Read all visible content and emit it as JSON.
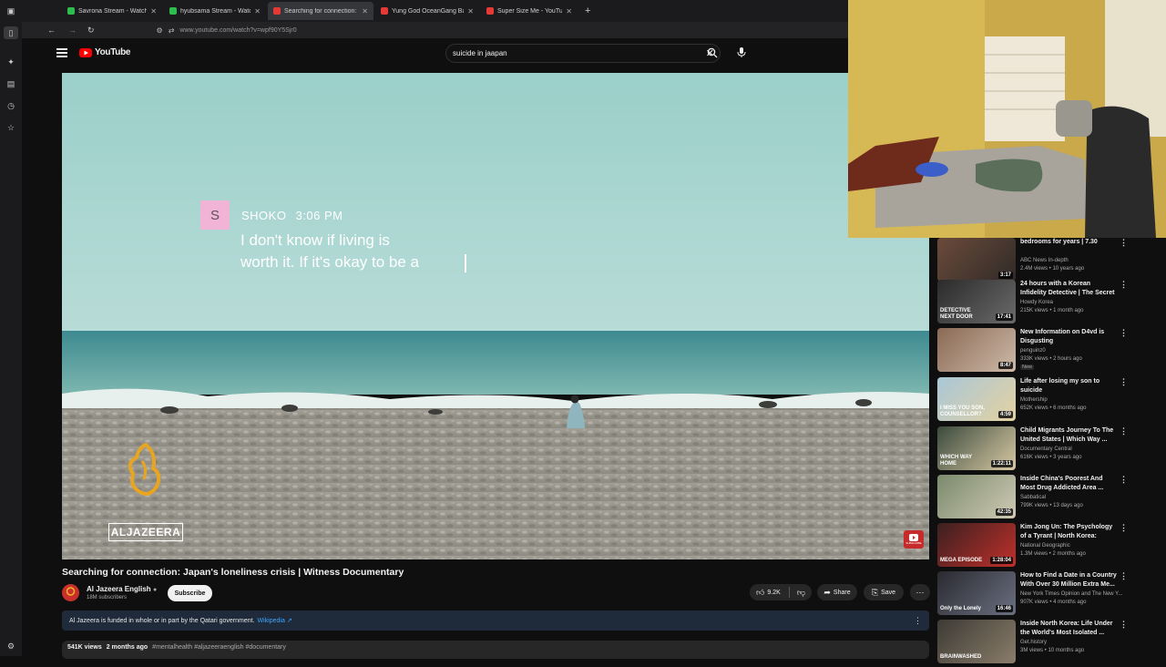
{
  "browser": {
    "tabs": [
      {
        "title": "Savrona Stream - Watch Live o",
        "color": "#2dbd4e",
        "active": false
      },
      {
        "title": "hyubsama Stream - Watch Live",
        "color": "#2dbd4e",
        "active": false
      },
      {
        "title": "Searching for connection: J",
        "color": "#e53935",
        "active": true
      },
      {
        "title": "Yung God OceanGang Based F",
        "color": "#e53935",
        "active": false
      },
      {
        "title": "Super Size Me - YouTube",
        "color": "#e53935",
        "active": false
      }
    ],
    "url": "www.youtube.com/watch?v=wpf90Y5Sjr0"
  },
  "masthead": {
    "logo_text": "YouTube",
    "search_value": "suicide in jaapan"
  },
  "video": {
    "overlay_initial": "S",
    "overlay_name": "SHOKO",
    "overlay_time": "3:06 PM",
    "overlay_line1": "I don't know if living is",
    "overlay_line2": "worth it. If it's okay to be a",
    "brand": "ALJAZEERA",
    "subscribe_overlay": "SUBSCRIBE"
  },
  "info": {
    "title": "Searching for connection: Japan's loneliness crisis | Witness Documentary",
    "channel": "Al Jazeera English",
    "subscribers": "18M subscribers",
    "subscribe": "Subscribe",
    "likes": "9.2K",
    "share": "Share",
    "save": "Save",
    "funding_text": "Al Jazeera is funded in whole or in part by the Qatari government.",
    "funding_link": "Wikipedia",
    "views": "541K views",
    "age": "2 months ago",
    "hashtags": "#mentalhealth #aljazeeraenglish #documentary"
  },
  "recommendations": [
    {
      "title": "bedrooms for years | 7.30",
      "channel": "ABC News In-depth",
      "meta": "2.4M views • 10 years ago",
      "duration": "3:17",
      "badge": ""
    },
    {
      "title": "24 hours with a Korean Infidelity Detective | The Secret Busines...",
      "channel": "Howdy Korea",
      "meta": "215K views • 1 month ago",
      "duration": "17:41",
      "badge": ""
    },
    {
      "title": "New Information on D4vd is Disgusting",
      "channel": "penguinz0",
      "meta": "333K views • 2 hours ago",
      "duration": "8:47",
      "badge": "New"
    },
    {
      "title": "Life after losing my son to suicide",
      "channel": "Mothership",
      "meta": "652K views • 6 months ago",
      "duration": "4:59",
      "badge": ""
    },
    {
      "title": "Child Migrants Journey To The United States | Which Way ...",
      "channel": "Documentary Central",
      "meta": "616K views • 3 years ago",
      "duration": "1:22:11",
      "badge": ""
    },
    {
      "title": "Inside China's Poorest And Most Drug Addicted Area ...",
      "channel": "Sabbatical",
      "meta": "799K views • 13 days ago",
      "duration": "42:35",
      "badge": ""
    },
    {
      "title": "Kim Jong Un: The Psychology of a Tyrant | North Korea: Insid...",
      "channel": "National Geographic",
      "meta": "1.3M views • 2 months ago",
      "duration": "1:28:04",
      "badge": ""
    },
    {
      "title": "How to Find a Date in a Country With Over 30 Million Extra Me...",
      "channel": "New York Times Opinion and The New Y...",
      "meta": "907K views • 4 months ago",
      "duration": "16:46",
      "badge": ""
    },
    {
      "title": "Inside North Korea: Life Under the World's Most Isolated ...",
      "channel": "Get.history",
      "meta": "3M views • 10 months ago",
      "duration": "",
      "badge": ""
    }
  ],
  "thumb_captions": [
    {
      "text": "DETECTIVE NEXT DOOR",
      "index": 1
    },
    {
      "text": "I MISS YOU SON, COUNSELLOR?",
      "index": 3
    },
    {
      "text": "WHICH WAY HOME",
      "index": 4
    },
    {
      "text": "MEGA EPISODE",
      "index": 6
    },
    {
      "text": "Only the Lonely",
      "index": 7
    },
    {
      "text": "BRAINWASHED",
      "index": 8
    }
  ]
}
